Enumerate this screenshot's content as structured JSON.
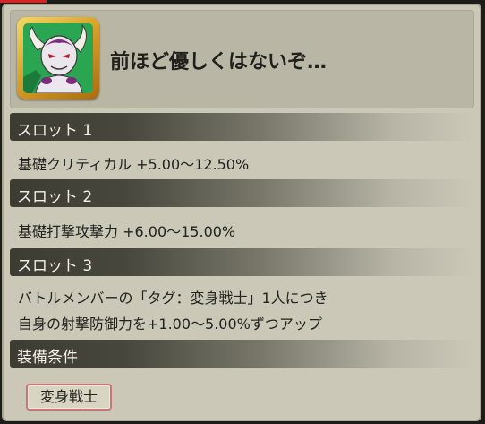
{
  "item": {
    "title": "前ほど優しくはないぞ…",
    "portrait": "frieza-character-icon"
  },
  "slots": [
    {
      "label": "スロット 1",
      "effect_lines": [
        "基礎クリティカル +5.00〜12.50%"
      ]
    },
    {
      "label": "スロット 2",
      "effect_lines": [
        "基礎打撃攻撃力 +6.00〜15.00%"
      ]
    },
    {
      "label": "スロット 3",
      "effect_lines": [
        "バトルメンバーの「タグ：変身戦士」1人につき",
        "自身の射撃防御力を+1.00〜5.00%ずつアップ"
      ]
    }
  ],
  "equip_conditions": {
    "label": "装備条件",
    "tags": [
      "変身戦士"
    ]
  },
  "colors": {
    "panel_bg": "#cbc8b8",
    "header_bg": "#b9b6a6",
    "bar_dark": "#3c3c33",
    "frame_gold": "#d9a12a",
    "tag_border": "#c9737a"
  }
}
